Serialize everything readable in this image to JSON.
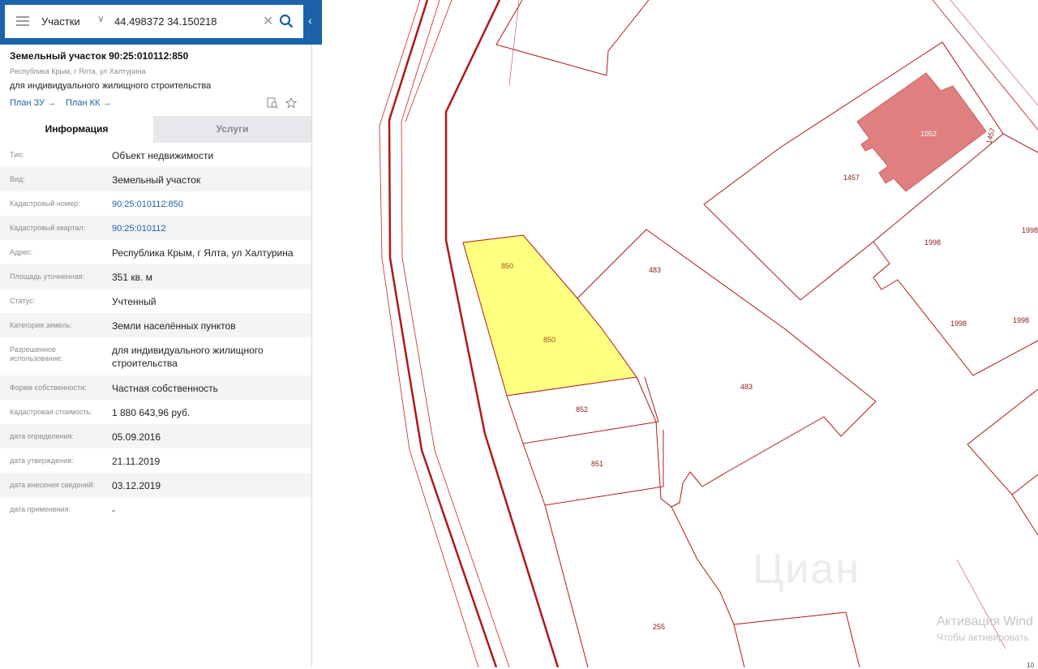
{
  "search": {
    "mode_label": "Участки",
    "query": "44.498372 34.150218"
  },
  "parcel": {
    "title": "Земельный участок 90:25:010112:850",
    "address_small": "Республика Крым, г Ялта, ул Халтурина",
    "purpose": "для индивидуального жилищного строительства",
    "link_zu": "План ЗУ →",
    "link_kk": "План КК →"
  },
  "tabs": {
    "info": "Информация",
    "services": "Услуги"
  },
  "info_rows": [
    {
      "key": "Тип:",
      "value": "Объект недвижимости"
    },
    {
      "key": "Вид:",
      "value": "Земельный участок"
    },
    {
      "key": "Кадастровый номер:",
      "value": "90:25:010112:850"
    },
    {
      "key": "Кадастровый квартал:",
      "value": "90:25:010112"
    },
    {
      "key": "Адрес:",
      "value": "Республика Крым, г Ялта, ул Халтурина"
    },
    {
      "key": "Площадь уточненная:",
      "value": "351 кв. м"
    },
    {
      "key": "Статус:",
      "value": "Учтенный"
    },
    {
      "key": "Категория земель:",
      "value": "Земли населённых пунктов"
    },
    {
      "key": "Разрешенное использование:",
      "value": "для индивидуального жилищного строительства"
    },
    {
      "key": "Форма собственности:",
      "value": "Частная собственность"
    },
    {
      "key": "Кадастровая стоимость:",
      "value": "1 880 643,96 руб."
    },
    {
      "key": "дата определения:",
      "value": "05.09.2016"
    },
    {
      "key": "дата утверждения:",
      "value": "21.11.2019"
    },
    {
      "key": "дата внесения сведений:",
      "value": "03.12.2019"
    },
    {
      "key": "дата применения:",
      "value": "-"
    }
  ],
  "map_labels": {
    "p850a": "850",
    "p850b": "850",
    "p852": "852",
    "p851": "851",
    "p483a": "483",
    "p483b": "483",
    "p255": "255",
    "p1457a": "1457",
    "p1457b": "1457",
    "p1052": "1052",
    "p1998a": "1998",
    "p1998b": "1998",
    "p1998c": "1998",
    "p1998d": "1998"
  },
  "watermark": "Циан",
  "activation": {
    "line1": "Активация Wind",
    "line2": "Чтобы активировать"
  },
  "corner_num": "10",
  "colors": {
    "accent": "#1b62a8",
    "parcel_selected": "#ffff80",
    "building": "#e07f7f",
    "boundary": "#b01818"
  }
}
